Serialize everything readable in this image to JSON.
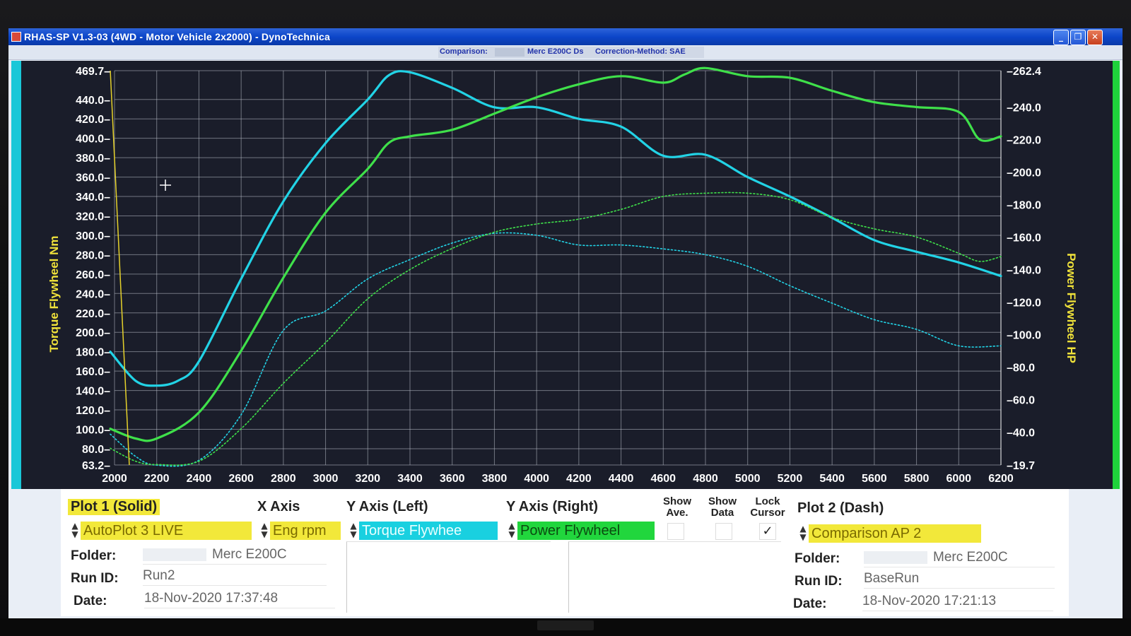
{
  "window": {
    "title": "RHAS-SP V1.3-03  (4WD - Motor Vehicle 2x2000) - DynoTechnica",
    "controls": [
      "_",
      "❐",
      "✕"
    ]
  },
  "info_strip": {
    "comparison_label": "Comparison:",
    "run_name": "Merc E200C Ds",
    "correction": "Correction-Method: SAE"
  },
  "colors": {
    "background": "#1a1d2a",
    "grid": "#b9bdc8",
    "torque": "#22d3e6",
    "power": "#3fe04a",
    "axis_label": "#f0e23a",
    "cursor_line": "#e6d22a"
  },
  "chart_data": {
    "type": "line",
    "xlabel": "",
    "ylabel_left": "Torque Flywheel Nm",
    "ylabel_right": "Power Flywheel HP",
    "xlim": [
      2000,
      6200
    ],
    "ylim_left": [
      63.2,
      469.7
    ],
    "ylim_right": [
      19.7,
      262.4
    ],
    "grid": true,
    "x_ticks": [
      2000,
      2200,
      2400,
      2600,
      2800,
      3000,
      3200,
      3400,
      3600,
      3800,
      4000,
      4200,
      4400,
      4600,
      4800,
      5000,
      5200,
      5400,
      5600,
      5800,
      6000,
      6200
    ],
    "y_left_ticks": [
      "469.7",
      "440.0",
      "420.0",
      "400.0",
      "380.0",
      "360.0",
      "340.0",
      "320.0",
      "300.0",
      "280.0",
      "260.0",
      "240.0",
      "220.0",
      "200.0",
      "180.0",
      "160.0",
      "140.0",
      "120.0",
      "100.0",
      "80.0",
      "63.2"
    ],
    "y_right_ticks": [
      "262.4",
      "240.0",
      "220.0",
      "200.0",
      "180.0",
      "160.0",
      "140.0",
      "120.0",
      "100.0",
      "80.0",
      "60.0",
      "40.0",
      "19.7"
    ],
    "cursor_rpm": [
      1980,
      2070
    ],
    "series": [
      {
        "axis": "left",
        "style": "solid",
        "color": "#22d3e6",
        "x": [
          1980,
          2100,
          2200,
          2300,
          2400,
          2600,
          2800,
          3000,
          3200,
          3300,
          3400,
          3600,
          3800,
          4000,
          4200,
          4400,
          4600,
          4800,
          5000,
          5200,
          5400,
          5600,
          5800,
          6000,
          6200
        ],
        "y": [
          180,
          150,
          145,
          150,
          170,
          255,
          335,
          395,
          440,
          465,
          468,
          452,
          432,
          432,
          420,
          412,
          382,
          383,
          360,
          340,
          318,
          295,
          283,
          272,
          258
        ]
      },
      {
        "axis": "right",
        "style": "solid",
        "color": "#3fe04a",
        "x": [
          1980,
          2100,
          2200,
          2400,
          2600,
          2800,
          3000,
          3200,
          3300,
          3400,
          3600,
          3800,
          4000,
          4200,
          4400,
          4600,
          4700,
          4800,
          5000,
          5200,
          5400,
          5600,
          5800,
          6000,
          6100,
          6200
        ],
        "y": [
          42,
          36,
          36,
          52,
          90,
          135,
          175,
          202,
          218,
          222,
          226,
          236,
          246,
          254,
          259,
          255,
          260,
          264,
          259,
          258,
          250,
          243,
          240,
          237,
          220,
          222
        ]
      },
      {
        "axis": "left",
        "style": "dash",
        "color": "#22d3e6",
        "x": [
          1980,
          2100,
          2200,
          2400,
          2600,
          2800,
          3000,
          3200,
          3400,
          3600,
          3800,
          4000,
          4200,
          4400,
          4600,
          4800,
          5000,
          5200,
          5400,
          5600,
          5800,
          6000,
          6200
        ],
        "y": [
          95,
          72,
          63,
          68,
          115,
          202,
          222,
          255,
          275,
          292,
          302,
          300,
          290,
          290,
          286,
          280,
          268,
          248,
          230,
          213,
          203,
          186,
          186
        ]
      },
      {
        "axis": "right",
        "style": "dash",
        "color": "#3fe04a",
        "x": [
          1980,
          2100,
          2200,
          2400,
          2600,
          2800,
          3000,
          3200,
          3400,
          3600,
          3800,
          4000,
          4200,
          4400,
          4600,
          4800,
          5000,
          5200,
          5400,
          5600,
          5800,
          6000,
          6100,
          6200
        ],
        "y": [
          30,
          22,
          20,
          22,
          42,
          70,
          95,
          122,
          140,
          153,
          163,
          168,
          171,
          177,
          185,
          187,
          187,
          183,
          172,
          165,
          160,
          150,
          145,
          148
        ]
      }
    ]
  },
  "controls": {
    "plot1_title": "Plot 1 (Solid)",
    "plot1_source": "AutoPlot 3 LIVE",
    "x_axis_title": "X Axis",
    "x_axis_value": "Eng rpm",
    "y_left_title": "Y Axis (Left)",
    "y_left_value": "Torque Flywhee",
    "y_right_title": "Y Axis (Right)",
    "y_right_value": "Power Flywheel",
    "show_ave": "Show Ave.",
    "show_data": "Show Data",
    "lock_cursor": "Lock Cursor",
    "lock_check": "✓",
    "plot2_title": "Plot 2 (Dash)",
    "plot2_source": "Comparison AP 2",
    "folder_label": "Folder:",
    "run_label": "Run ID:",
    "date_label": "Date:",
    "plot1_folder": "Merc E200C",
    "plot1_run": "Run2",
    "plot1_date": "18-Nov-2020  17:37:48",
    "plot2_folder": "Merc E200C",
    "plot2_run": "BaseRun",
    "plot2_date": "18-Nov-2020  17:21:13"
  }
}
